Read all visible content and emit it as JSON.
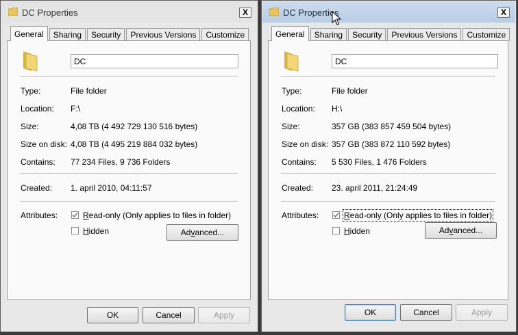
{
  "icons": {
    "folder": "folder-icon",
    "close": "close-icon",
    "checkmark": "checkmark-icon",
    "cursor": "mouse-cursor-icon"
  },
  "colors": {
    "folder_yellow": "#e8c85a",
    "active_title": "#c3d5ec",
    "inactive_title": "#e4e4e4"
  },
  "labels": {
    "type": "Type:",
    "location": "Location:",
    "size": "Size:",
    "size_on_disk": "Size on disk:",
    "contains": "Contains:",
    "created": "Created:",
    "attributes": "Attributes:"
  },
  "left": {
    "title": "DC Properties",
    "close": "X",
    "tabs": [
      "General",
      "Sharing",
      "Security",
      "Previous Versions",
      "Customize"
    ],
    "name": "DC",
    "type": "File folder",
    "location": "F:\\",
    "size": "4,08 TB (4 492 729 130 516 bytes)",
    "size_on_disk": "4,08 TB (4 495 219 884 032 bytes)",
    "contains": "77 234 Files, 9 736 Folders",
    "created": "1. april 2010, 04:11:57",
    "readonly": {
      "prefix": "R",
      "rest": "ead-only (Only applies to files in folder)",
      "checked": true
    },
    "hidden": {
      "prefix": "H",
      "rest": "idden",
      "checked": false
    },
    "advanced": {
      "prefix": "Ad",
      "mnemonic": "v",
      "suffix": "anced..."
    },
    "ok": "OK",
    "cancel": "Cancel",
    "apply": "Apply"
  },
  "right": {
    "title": "DC Properties",
    "close": "X",
    "tabs": [
      "General",
      "Sharing",
      "Security",
      "Previous Versions",
      "Customize"
    ],
    "name": "DC",
    "type": "File folder",
    "location": "H:\\",
    "size": "357 GB (383 857 459 504 bytes)",
    "size_on_disk": "357 GB (383 872 110 592 bytes)",
    "contains": "5 530 Files, 1 476 Folders",
    "created": "23. april 2011, 21:24:49",
    "readonly": {
      "prefix": "R",
      "rest": "ead-only (Only applies to files in folder)",
      "checked": true
    },
    "hidden": {
      "prefix": "H",
      "rest": "idden",
      "checked": false
    },
    "advanced": {
      "prefix": "Ad",
      "mnemonic": "v",
      "suffix": "anced..."
    },
    "ok": "OK",
    "cancel": "Cancel",
    "apply": "Apply"
  }
}
